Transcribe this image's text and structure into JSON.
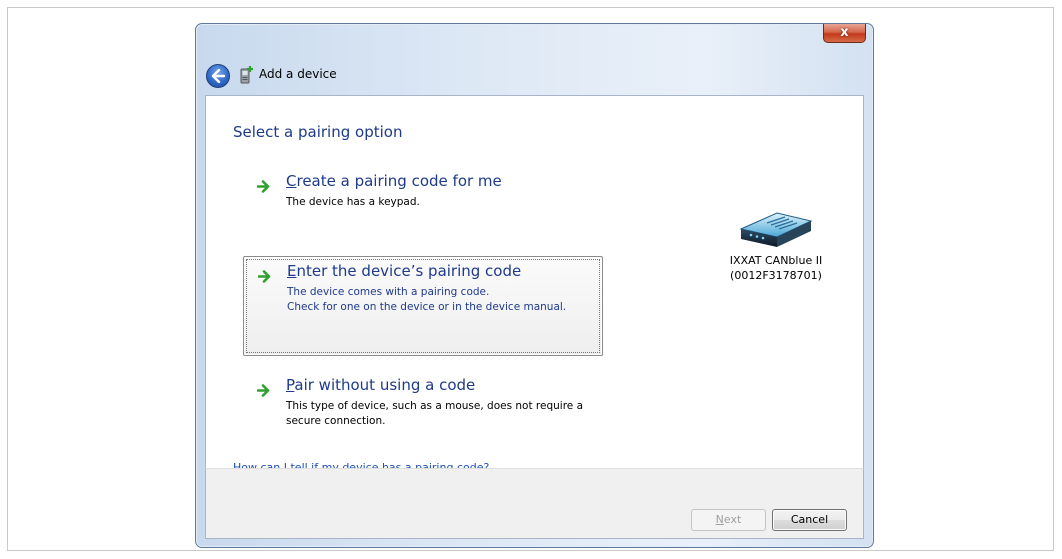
{
  "window": {
    "title": "Add a device",
    "close_label": "x"
  },
  "content": {
    "heading": "Select a pairing option",
    "options": [
      {
        "title_accel": "C",
        "title_rest": "reate a pairing code for me",
        "desc": [
          "The device has a keypad."
        ]
      },
      {
        "title_accel": "E",
        "title_rest": "nter the device’s pairing code",
        "desc": [
          "The device comes with a pairing code.",
          "Check for one on the device or in the device manual."
        ],
        "selected": true
      },
      {
        "title_accel": "P",
        "title_rest": "air without using a code",
        "desc": [
          "This type of device, such as a mouse, does not require a",
          "secure connection."
        ]
      }
    ],
    "device": {
      "name": "IXXAT CANblue II",
      "address": "(0012F3178701)"
    },
    "help_link": "How can I tell if my device has a pairing code?"
  },
  "footer": {
    "next_accel": "N",
    "next_rest": "ext",
    "cancel_label": "Cancel"
  },
  "icons": {
    "back": "back-arrow-icon",
    "title": "add-device-icon",
    "option_arrow": "green-arrow-icon",
    "device": "network-device-icon"
  },
  "colors": {
    "heading": "#1e3a8a",
    "link": "#1a4fbf",
    "arrow": "#2fa12f",
    "close": "#c4391c"
  }
}
